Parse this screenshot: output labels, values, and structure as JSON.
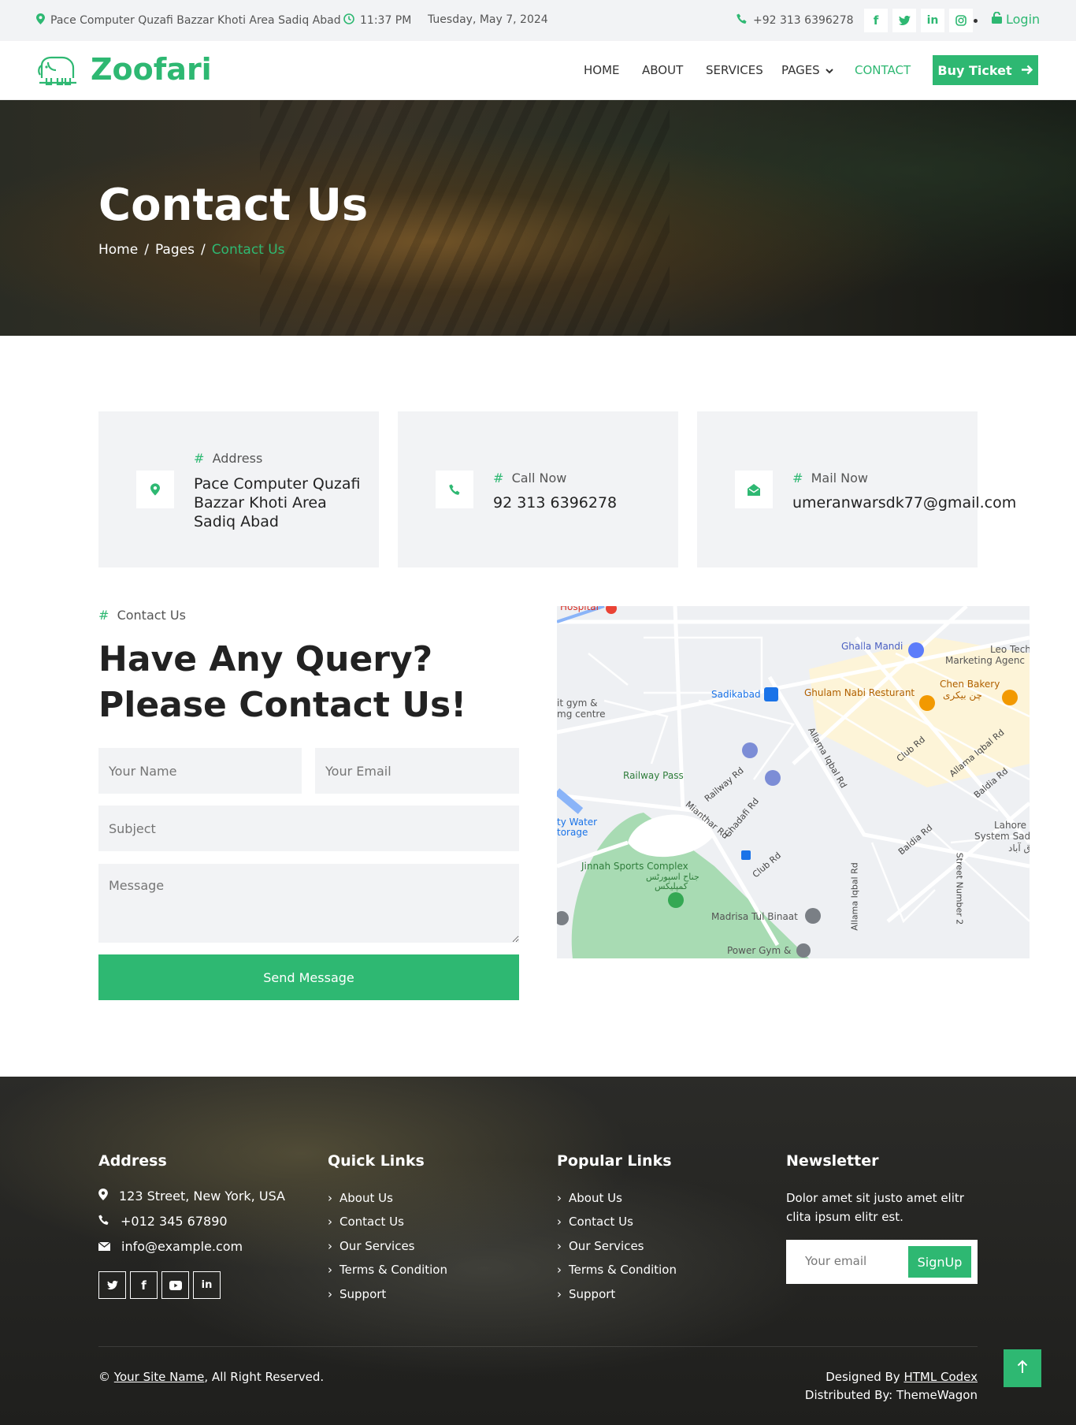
{
  "topbar": {
    "address": "Pace Computer Quzafi Bazzar Khoti Area Sadiq Abad",
    "time": "11:37 PM",
    "date": "Tuesday, May 7, 2024",
    "phone": "+92 313 6396278",
    "login": "Login",
    "socials": [
      "facebook-icon",
      "twitter-icon",
      "linkedin-icon",
      "instagram-icon"
    ]
  },
  "nav": {
    "brand": "Zoofari",
    "links": [
      "HOME",
      "ABOUT",
      "SERVICES",
      "PAGES",
      "CONTACT"
    ],
    "active": "CONTACT",
    "cta": "Buy Ticket"
  },
  "hero": {
    "title": "Contact Us",
    "breadcrumb": [
      "Home",
      "Pages",
      "Contact Us"
    ],
    "separator": "/"
  },
  "cards": [
    {
      "label": "Address",
      "value": "Pace Computer Quzafi Bazzar Khoti Area Sadiq Abad",
      "icon": "map-pin-icon"
    },
    {
      "label": "Call Now",
      "value": "92 313 6396278",
      "icon": "phone-icon"
    },
    {
      "label": "Mail Now",
      "value": "umeranwarsdk77@gmail.com",
      "icon": "envelope-open-icon"
    }
  ],
  "contact": {
    "sublabel": "Contact Us",
    "title_line1": "Have Any Query?",
    "title_line2": "Please Contact Us!",
    "name_placeholder": "Your Name",
    "email_placeholder": "Your Email",
    "subject_placeholder": "Subject",
    "message_placeholder": "Message",
    "send": "Send Message"
  },
  "map": {
    "labels": [
      "Hospital",
      "Ghalla Mandi",
      "Leo Tech",
      "Marketing Agenc",
      "it gym &",
      "mg centre",
      "Sadikabad",
      "Ghulam Nabi Resturant",
      "Chen Bakery",
      "چن بیکری",
      "Railway Pass",
      "Railway Rd",
      "Allama Iqbal Rd",
      "Club Rd",
      "Allama Iqbal Rd",
      "Baldia Rd",
      "Mianthar Rd",
      "Ghadafi Rd",
      "ty Water",
      "torage",
      "Lahore",
      "System Sad",
      "ق آباد",
      "Jinnah Sports Complex",
      "جناح اسپورٹس",
      "کمپلیکس",
      "Club Rd",
      "Baldia Rd",
      "Madrisa Tul Binaat",
      "Allama Iqbal Rd",
      "Street Number 2",
      "Power Gym &"
    ]
  },
  "footer": {
    "address_title": "Address",
    "address": "123 Street, New York, USA",
    "phone": "+012 345 67890",
    "email": "info@example.com",
    "socials": [
      "twitter-icon",
      "facebook-icon",
      "youtube-icon",
      "linkedin-icon"
    ],
    "quick_title": "Quick Links",
    "quick_links": [
      "About Us",
      "Contact Us",
      "Our Services",
      "Terms & Condition",
      "Support"
    ],
    "popular_title": "Popular Links",
    "popular_links": [
      "About Us",
      "Contact Us",
      "Our Services",
      "Terms & Condition",
      "Support"
    ],
    "newsletter_title": "Newsletter",
    "newsletter_text": "Dolor amet sit justo amet elitr clita ipsum elitr est.",
    "newsletter_placeholder": "Your email",
    "newsletter_button": "SignUp",
    "copyright_symbol": "©",
    "site_name": "Your Site Name",
    "rights": ", All Right Reserved.",
    "designed_by": "Designed By",
    "designer": "HTML Codex",
    "distributed_by": "Distributed By: ThemeWagon"
  },
  "colors": {
    "accent": "#2eb872",
    "dark": "#222222",
    "light_bg": "#f2f3f5"
  }
}
